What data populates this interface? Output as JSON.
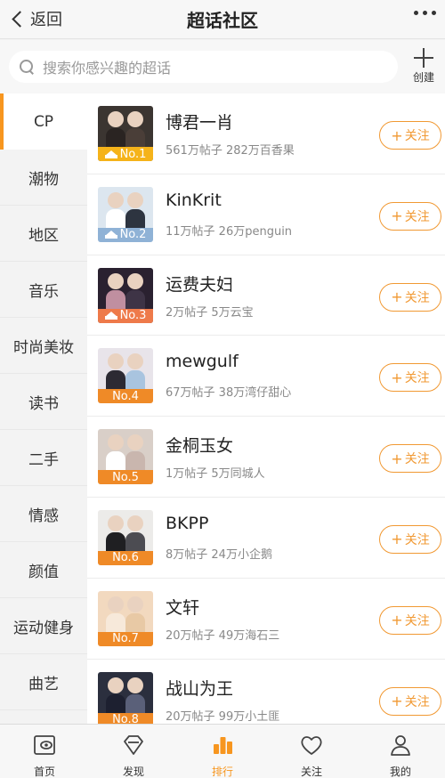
{
  "header": {
    "back_label": "返回",
    "title": "超话社区"
  },
  "search": {
    "placeholder": "搜索你感兴趣的超话",
    "create_label": "创建"
  },
  "sidebar": {
    "items": [
      {
        "label": "CP",
        "active": true
      },
      {
        "label": "潮物",
        "active": false
      },
      {
        "label": "地区",
        "active": false
      },
      {
        "label": "音乐",
        "active": false
      },
      {
        "label": "时尚美妆",
        "active": false
      },
      {
        "label": "读书",
        "active": false
      },
      {
        "label": "二手",
        "active": false
      },
      {
        "label": "情感",
        "active": false
      },
      {
        "label": "颜值",
        "active": false
      },
      {
        "label": "运动健身",
        "active": false
      },
      {
        "label": "曲艺",
        "active": false
      }
    ]
  },
  "list": {
    "follow_label": "关注",
    "items": [
      {
        "rank": "No.1",
        "name": "博君一肖",
        "stats": "561万帖子 282万百香果",
        "badge_color": "#f5b31a",
        "crown": true,
        "bg": "#3b3531",
        "body1": "#2a2422",
        "body2": "#4a3e38"
      },
      {
        "rank": "No.2",
        "name": "KinKrit",
        "stats": "11万帖子 26万penguin",
        "badge_color": "#8fb2d6",
        "crown": true,
        "bg": "#dce6ef",
        "body1": "#ffffff",
        "body2": "#2d3440"
      },
      {
        "rank": "No.3",
        "name": "运费夫妇",
        "stats": "2万帖子 5万云宝",
        "badge_color": "#ee7a4a",
        "crown": true,
        "bg": "#2a2130",
        "body1": "#c08fa0",
        "body2": "#3e3446"
      },
      {
        "rank": "No.4",
        "name": "mewgulf",
        "stats": "67万帖子 38万湾仔甜心",
        "badge_color": "#ef8a27",
        "crown": false,
        "bg": "#e8e4ea",
        "body1": "#2c2a33",
        "body2": "#a9c4df"
      },
      {
        "rank": "No.5",
        "name": "金桐玉女",
        "stats": "1万帖子 5万同城人",
        "badge_color": "#ef8a27",
        "crown": false,
        "bg": "#d9cfc8",
        "body1": "#ffffff",
        "body2": "#c9b6ae"
      },
      {
        "rank": "No.6",
        "name": "BKPP",
        "stats": "8万帖子 24万小企鹅",
        "badge_color": "#ef8a27",
        "crown": false,
        "bg": "#ecebe9",
        "body1": "#1f1f22",
        "body2": "#4c4c52"
      },
      {
        "rank": "No.7",
        "name": "文轩",
        "stats": "20万帖子 49万海石三",
        "badge_color": "#ef8a27",
        "crown": false,
        "bg": "#f2d9bf",
        "body1": "#f7e9da",
        "body2": "#e8c9a5"
      },
      {
        "rank": "No.8",
        "name": "战山为王",
        "stats": "20万帖子 99万小土匪",
        "badge_color": "#ef8a27",
        "crown": false,
        "bg": "#2b2f3e",
        "body1": "#1d2030",
        "body2": "#5a6079"
      }
    ]
  },
  "tabbar": {
    "items": [
      {
        "label": "首页",
        "icon": "home-eye-icon",
        "active": false
      },
      {
        "label": "发现",
        "icon": "discover-diamond-icon",
        "active": false
      },
      {
        "label": "排行",
        "icon": "ranking-bars-icon",
        "active": true
      },
      {
        "label": "关注",
        "icon": "heart-icon",
        "active": false
      },
      {
        "label": "我的",
        "icon": "profile-icon",
        "active": false
      }
    ]
  },
  "colors": {
    "accent": "#f7961f",
    "follow": "#f19933"
  }
}
